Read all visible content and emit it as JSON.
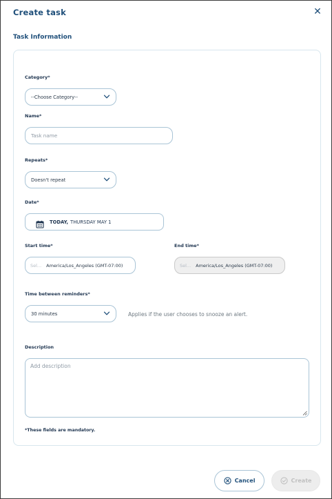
{
  "dialog": {
    "title": "Create task",
    "close_icon": "close-icon",
    "section_title": "Task Information"
  },
  "form": {
    "category": {
      "label": "Category*",
      "value": "--Choose Category--",
      "icon": "chevron-down-icon"
    },
    "name": {
      "label": "Name*",
      "placeholder": "Task name"
    },
    "repeats": {
      "label": "Repeats*",
      "value": "Doesn't repeat",
      "icon": "chevron-down-icon"
    },
    "date": {
      "label": "Date*",
      "today": "TODAY,",
      "date_text": "THURSDAY MAY 1",
      "icon": "calendar-icon"
    },
    "start_time": {
      "label": "Start time*",
      "select_placeholder": "Sel...",
      "timezone": "America/Los_Angeles (GMT-07:00)"
    },
    "end_time": {
      "label": "End time*",
      "select_placeholder": "Sel...",
      "timezone": "America/Los_Angeles (GMT-07:00)"
    },
    "reminders": {
      "label": "Time between reminders*",
      "value": "30 minutes",
      "hint": "Applies if the user chooses to snooze an alert.",
      "icon": "chevron-down-icon"
    },
    "description": {
      "label": "Description",
      "placeholder": "Add description"
    },
    "mandatory_note": "*These fields are mandatory."
  },
  "footer": {
    "cancel_label": "Cancel",
    "cancel_icon": "cancel-circle-icon",
    "create_label": "Create",
    "create_icon": "check-circle-icon"
  },
  "colors": {
    "accent": "#1f4f7a",
    "border": "#a9c4d6",
    "disabled_bg": "#ededed"
  }
}
